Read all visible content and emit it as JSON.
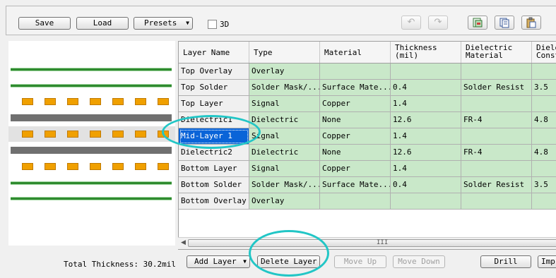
{
  "toolbar": {
    "save_label": "Save",
    "load_label": "Load",
    "presets_label": "Presets",
    "threed_label": "3D",
    "undo_icon": "undo-icon",
    "redo_icon": "redo-icon",
    "copy_image_icon": "copy-image-icon",
    "copy_icon": "copy-icon",
    "paste_icon": "paste-icon"
  },
  "grid": {
    "headers": [
      {
        "line1": "Layer Name",
        "line2": ""
      },
      {
        "line1": "Type",
        "line2": ""
      },
      {
        "line1": "Material",
        "line2": ""
      },
      {
        "line1": "Thickness",
        "line2": "(mil)"
      },
      {
        "line1": "Dielectric",
        "line2": "Material"
      },
      {
        "line1": "Diele",
        "line2": "Const"
      }
    ],
    "rows": [
      {
        "name": "Top Overlay",
        "type": "Overlay",
        "material": "",
        "thickness": "",
        "dielectric_material": "",
        "dielectric_constant": ""
      },
      {
        "name": "Top Solder",
        "type": "Solder Mask/...",
        "material": "Surface Mate...",
        "thickness": "0.4",
        "dielectric_material": "Solder Resist",
        "dielectric_constant": "3.5"
      },
      {
        "name": "Top Layer",
        "type": "Signal",
        "material": "Copper",
        "thickness": "1.4",
        "dielectric_material": "",
        "dielectric_constant": ""
      },
      {
        "name": "Dielectric1",
        "type": "Dielectric",
        "material": "None",
        "thickness": "12.6",
        "dielectric_material": "FR-4",
        "dielectric_constant": "4.8"
      },
      {
        "name": "Mid-Layer 1",
        "type": "Signal",
        "material": "Copper",
        "thickness": "1.4",
        "dielectric_material": "",
        "dielectric_constant": ""
      },
      {
        "name": "Dielectric2",
        "type": "Dielectric",
        "material": "None",
        "thickness": "12.6",
        "dielectric_material": "FR-4",
        "dielectric_constant": "4.8"
      },
      {
        "name": "Bottom Layer",
        "type": "Signal",
        "material": "Copper",
        "thickness": "1.4",
        "dielectric_material": "",
        "dielectric_constant": ""
      },
      {
        "name": "Bottom Solder",
        "type": "Solder Mask/...",
        "material": "Surface Mate...",
        "thickness": "0.4",
        "dielectric_material": "Solder Resist",
        "dielectric_constant": "3.5"
      },
      {
        "name": "Bottom Overlay",
        "type": "Overlay",
        "material": "",
        "thickness": "",
        "dielectric_material": "",
        "dielectric_constant": ""
      }
    ],
    "selected_row": 4,
    "scroll_grip": "III"
  },
  "footer": {
    "total_thickness": "Total Thickness: 30.2mil",
    "add_layer_label": "Add Layer",
    "delete_layer_label": "Delete Layer",
    "move_up_label": "Move Up",
    "move_down_label": "Move Down",
    "drill_label": "Drill",
    "import_label": "Imp"
  },
  "colors": {
    "highlight_ellipse": "#22c6c6",
    "cell_green": "#c9e8c9",
    "selection_blue": "#0a64d8",
    "pad_orange": "#f0a000",
    "overlay_green": "#2f8a2f"
  }
}
